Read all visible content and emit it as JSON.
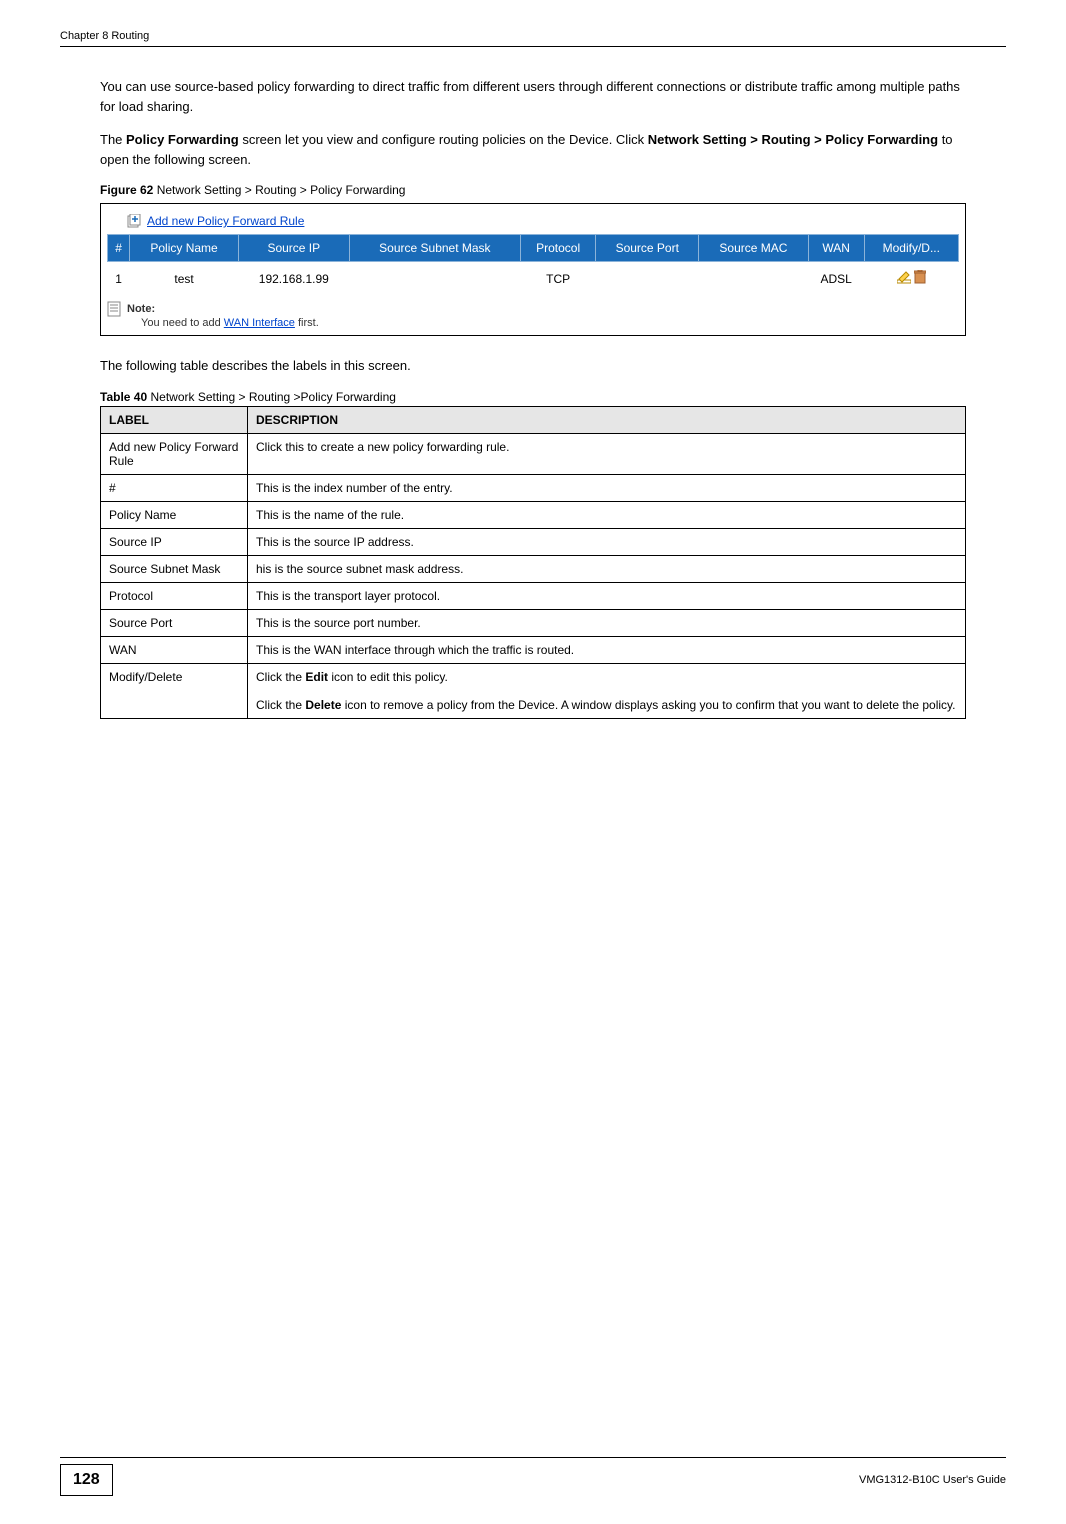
{
  "header": {
    "chapter": "Chapter 8 Routing"
  },
  "para1": "You can use source-based policy forwarding to direct traffic from different users through different connections or distribute traffic among multiple paths for load sharing.",
  "para2_pre": "The ",
  "para2_b1": "Policy Forwarding",
  "para2_mid1": " screen let you view and configure routing policies on the Device. Click ",
  "para2_b2": "Network Setting > Routing > Policy Forwarding",
  "para2_post": " to open the following screen.",
  "figure_caption_bold": "Figure 62",
  "figure_caption_rest": "   Network Setting > Routing > Policy Forwarding",
  "screenshot": {
    "add_link": "Add new Policy Forward Rule",
    "headers": [
      "#",
      "Policy Name",
      "Source IP",
      "Source Subnet Mask",
      "Protocol",
      "Source Port",
      "Source MAC",
      "WAN",
      "Modify/D..."
    ],
    "row": {
      "num": "1",
      "policy_name": "test",
      "source_ip": "192.168.1.99",
      "subnet": "",
      "protocol": "TCP",
      "source_port": "",
      "source_mac": "",
      "wan": "ADSL"
    },
    "note_label": "Note:",
    "note_pre": "You need to add ",
    "note_link": "WAN Interface",
    "note_post": " first."
  },
  "para3": "The following table describes the labels in this screen.",
  "table_caption_bold": "Table 40",
  "table_caption_rest": "   Network Setting > Routing >Policy Forwarding",
  "desc_table": {
    "header_label": "LABEL",
    "header_desc": "DESCRIPTION",
    "rows": [
      {
        "label": "Add new Policy Forward Rule",
        "desc": "Click this to create a new policy forwarding rule."
      },
      {
        "label": "#",
        "desc": "This is the index number of the entry."
      },
      {
        "label": "Policy Name",
        "desc": "This is the name of the rule."
      },
      {
        "label": "Source IP",
        "desc": "This is the source IP address."
      },
      {
        "label": "Source Subnet Mask",
        "desc": "his is the source subnet mask address."
      },
      {
        "label": "Protocol",
        "desc": "This is the transport layer protocol."
      },
      {
        "label": "Source Port",
        "desc": "This is the source port number."
      },
      {
        "label": "WAN",
        "desc": "This is the WAN interface through which the traffic is routed."
      }
    ],
    "modify_label": "Modify/Delete",
    "modify_line1_pre": "Click the ",
    "modify_line1_bold": "Edit",
    "modify_line1_post": " icon to edit this policy.",
    "modify_line2_pre": "Click the ",
    "modify_line2_bold": "Delete",
    "modify_line2_post": " icon to remove a policy from the Device. A window displays asking you to confirm that you want to delete the policy."
  },
  "footer": {
    "page": "128",
    "guide": "VMG1312-B10C User's Guide"
  }
}
